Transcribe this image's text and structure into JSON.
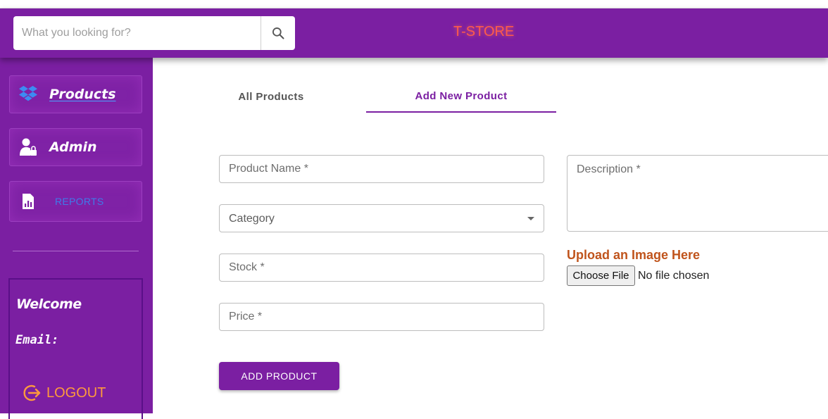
{
  "header": {
    "search_placeholder": "What you looking for?",
    "store_title": "T-STORE"
  },
  "sidebar": {
    "items": [
      {
        "label": "Products",
        "icon": "dropbox-icon"
      },
      {
        "label": "Admin",
        "icon": "user-lock-icon"
      },
      {
        "label": "REPORTS",
        "icon": "report-chart-icon"
      }
    ],
    "welcome": "Welcome",
    "email_label": "Email:",
    "logout_label": "LOGOUT"
  },
  "tabs": [
    {
      "label": "All Products",
      "active": false
    },
    {
      "label": "Add New Product",
      "active": true
    }
  ],
  "form": {
    "product_name_placeholder": "Product Name *",
    "category_value": "Category",
    "stock_placeholder": "Stock *",
    "price_placeholder": "Price *",
    "description_placeholder": "Description *",
    "upload_title": "Upload an Image Here",
    "choose_file_label": "Choose File",
    "no_file_text": "No file chosen",
    "submit_label": "ADD PRODUCT"
  },
  "colors": {
    "primary": "#7b1fa2",
    "title": "#ff5a4a",
    "upload_title": "#c0541c",
    "logout": "#ff9a3c",
    "reports_link": "#3f7bea"
  }
}
